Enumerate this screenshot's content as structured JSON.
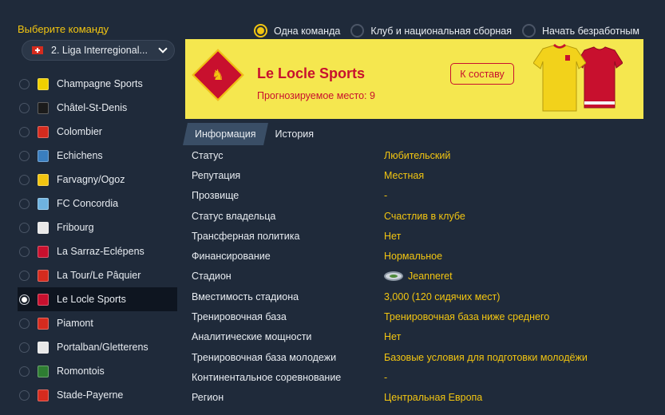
{
  "left": {
    "title": "Выберите команду",
    "league": "2. Liga Interregional...",
    "teams": [
      {
        "name": "Champagne Sports",
        "color": "#f0d000"
      },
      {
        "name": "Châtel-St-Denis",
        "color": "#1b1b1b"
      },
      {
        "name": "Colombier",
        "color": "#d52b1e"
      },
      {
        "name": "Echichens",
        "color": "#3a7ebf"
      },
      {
        "name": "Farvagny/Ogoz",
        "color": "#f2c511"
      },
      {
        "name": "FC Concordia",
        "color": "#6fb3e0"
      },
      {
        "name": "Fribourg",
        "color": "#e8e8e8"
      },
      {
        "name": "La Sarraz-Eclépens",
        "color": "#c8102e"
      },
      {
        "name": "La Tour/Le Pâquier",
        "color": "#d52b1e"
      },
      {
        "name": "Le Locle Sports",
        "color": "#c8102e"
      },
      {
        "name": "Piamont",
        "color": "#d52b1e"
      },
      {
        "name": "Portalban/Gletterens",
        "color": "#e8e8e8"
      },
      {
        "name": "Romontois",
        "color": "#2e7d32"
      },
      {
        "name": "Stade-Payerne",
        "color": "#d52b1e"
      }
    ],
    "selected_index": 9
  },
  "modes": [
    {
      "label": "Одна команда",
      "selected": true
    },
    {
      "label": "Клуб и национальная сборная",
      "selected": false
    },
    {
      "label": "Начать безработным",
      "selected": false
    }
  ],
  "banner": {
    "club_name": "Le Locle Sports",
    "predicted": "Прогнозируемое место: 9",
    "squad_button": "К составу",
    "badge_icon": "club-crest-icon",
    "home_shirt_color": "#f2d21b",
    "away_shirt_color": "#c8102e"
  },
  "tabs": [
    {
      "label": "Информация",
      "active": true
    },
    {
      "label": "История",
      "active": false
    }
  ],
  "info": [
    {
      "key": "Статус",
      "value": "Любительский"
    },
    {
      "key": "Репутация",
      "value": "Местная"
    },
    {
      "key": "Прозвище",
      "value": "-"
    },
    {
      "key": "Статус владельца",
      "value": "Счастлив в клубе"
    },
    {
      "key": "Трансферная политика",
      "value": "Нет"
    },
    {
      "key": "Финансирование",
      "value": "Нормальное"
    },
    {
      "key": "Стадион",
      "value": "Jeanneret",
      "icon": "stadium-icon"
    },
    {
      "key": "Вместимость стадиона",
      "value": "3,000 (120 сидячих мест)"
    },
    {
      "key": "Тренировочная база",
      "value": "Тренировочная база ниже среднего"
    },
    {
      "key": "Аналитические мощности",
      "value": "Нет"
    },
    {
      "key": "Тренировочная база молодежи",
      "value": "Базовые условия для подготовки молодёжи"
    },
    {
      "key": "Континентальное соревнование",
      "value": "-"
    },
    {
      "key": "Регион",
      "value": "Центральная Европа"
    }
  ]
}
